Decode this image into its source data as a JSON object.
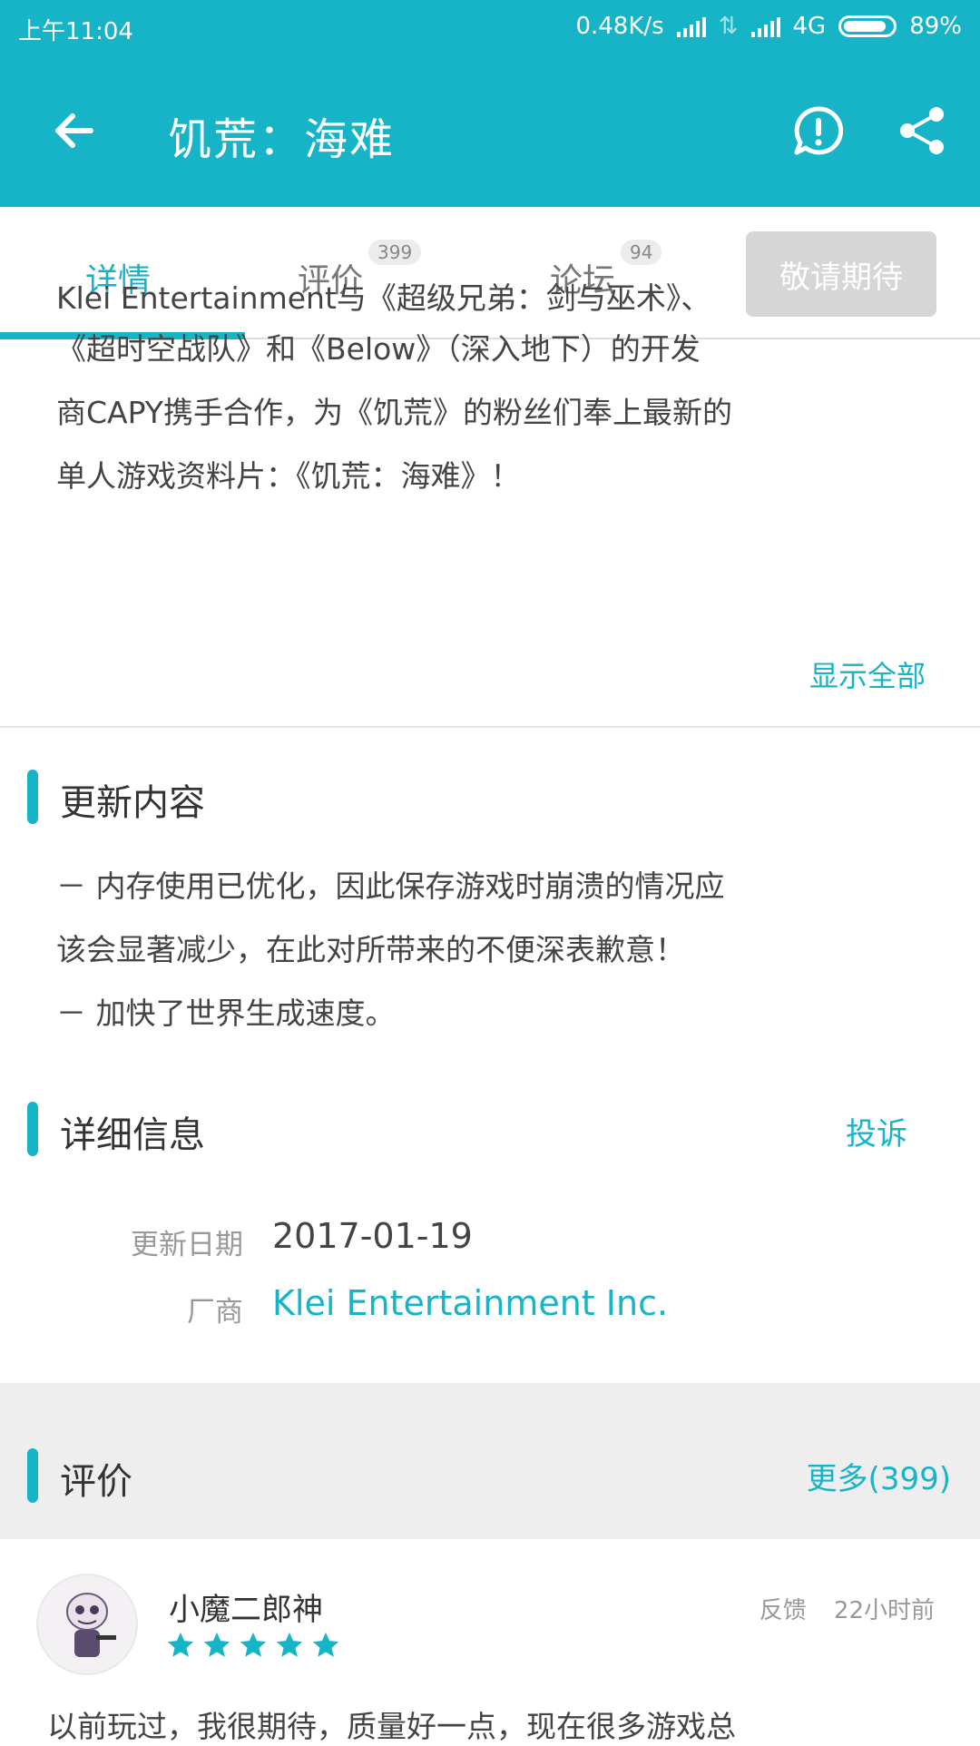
{
  "status_bar": {
    "time": "上午11:04",
    "speed": "0.48K/s",
    "network": "4G",
    "battery": "89%",
    "battery_level": 0.89
  },
  "app_bar": {
    "title": "饥荒：海难",
    "back_icon": "arrow-left-icon",
    "report_icon": "exclamation-circle-icon",
    "share_icon": "share-icon"
  },
  "tabs": [
    {
      "label": "详情",
      "active": true
    },
    {
      "label": "评价",
      "count": "399"
    },
    {
      "label": "论坛",
      "count": "94"
    }
  ],
  "expect_button": "敬请期待",
  "description": {
    "partial_top": "Klei Entertainment与《超级兄弟：剑与巫术》、",
    "lines": [
      "《超时空战队》和《Below》（深入地下）的开发",
      "商CAPY携手合作，为《饥荒》的粉丝们奉上最新的",
      "单人游戏资料片：《饥荒：海难》！"
    ],
    "show_all": "显示全部"
  },
  "changelog": {
    "title": "更新内容",
    "lines": [
      "－ 内存使用已优化，因此保存游戏时崩溃的情况应",
      "该会显著减少，在此对所带来的不便深表歉意！",
      "－ 加快了世界生成速度。"
    ]
  },
  "details": {
    "title": "详细信息",
    "complaint": "投诉",
    "update_date_label": "更新日期",
    "update_date": "2017-01-19",
    "vendor_label": "厂商",
    "vendor": "Klei Entertainment Inc."
  },
  "reviews": {
    "title": "评价",
    "more": "更多(399)",
    "items": [
      {
        "user": "小魔二郎神",
        "rating": 5,
        "feedback": "反馈",
        "time": "22小时前",
        "text": "以前玩过，我很期待，质量好一点，现在很多游戏总"
      }
    ]
  },
  "colors": {
    "accent": "#17b4c8",
    "disabled": "#d6d6d6"
  }
}
